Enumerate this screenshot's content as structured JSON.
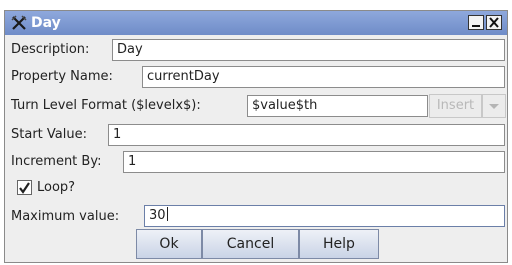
{
  "window": {
    "title": "Day",
    "icon": "crossed-swords-icon",
    "controls": [
      "minimize-icon",
      "close-icon"
    ]
  },
  "form": {
    "description": {
      "label": "Description:",
      "value": "Day"
    },
    "property_name": {
      "label": "Property Name:",
      "value": "currentDay"
    },
    "turn_level_format": {
      "label": "Turn Level Format ($levelx$):",
      "value": "$value$th",
      "insert_label": "Insert"
    },
    "start_value": {
      "label": "Start Value:",
      "value": "1"
    },
    "increment_by": {
      "label": "Increment By:",
      "value": "1"
    },
    "loop": {
      "label": "Loop?",
      "checked": true
    },
    "maximum_value": {
      "label": "Maximum value:",
      "value": "30"
    }
  },
  "buttons": {
    "ok": "Ok",
    "cancel": "Cancel",
    "help": "Help"
  },
  "colors": {
    "titlebar": "#7d98d2",
    "dialog_bg": "#eeeeee",
    "button_border": "#7d8aa6"
  }
}
